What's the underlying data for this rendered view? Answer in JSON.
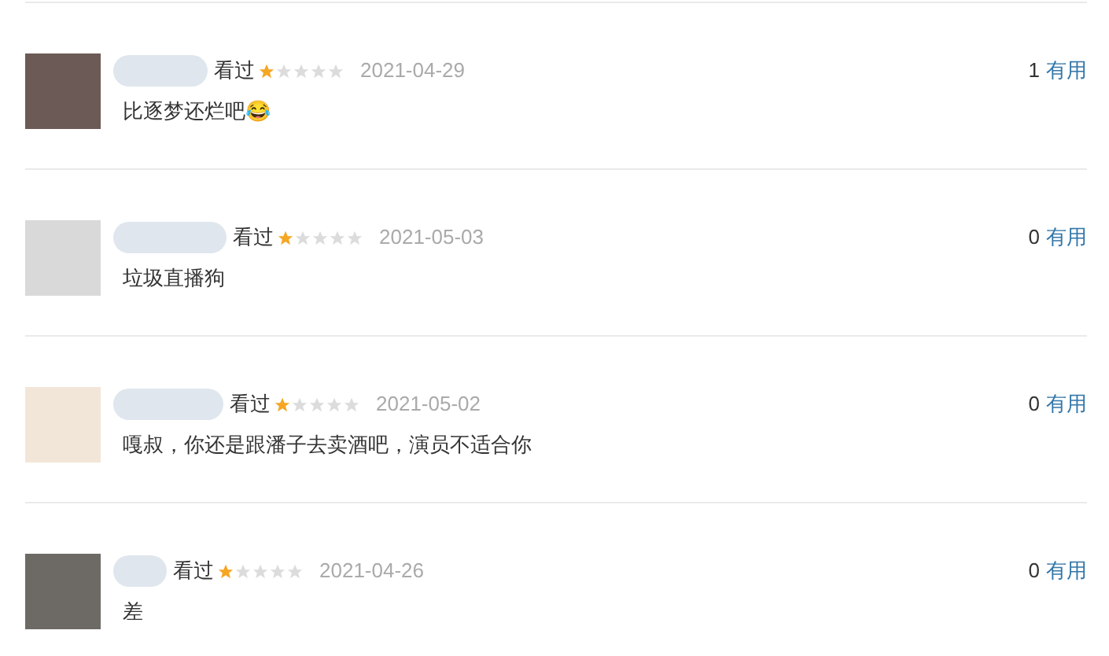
{
  "comments": [
    {
      "status": "看过",
      "stars": 1,
      "date": "2021-04-29",
      "votes": "1",
      "votes_label": "有用",
      "text": "比逐梦还烂吧😂"
    },
    {
      "status": "看过",
      "stars": 1,
      "date": "2021-05-03",
      "votes": "0",
      "votes_label": "有用",
      "text": "垃圾直播狗"
    },
    {
      "status": "看过",
      "stars": 1,
      "date": "2021-05-02",
      "votes": "0",
      "votes_label": "有用",
      "text": "嘎叔，你还是跟潘子去卖酒吧，演员不适合你"
    },
    {
      "status": "看过",
      "stars": 1,
      "date": "2021-04-26",
      "votes": "0",
      "votes_label": "有用",
      "text": "差"
    }
  ]
}
